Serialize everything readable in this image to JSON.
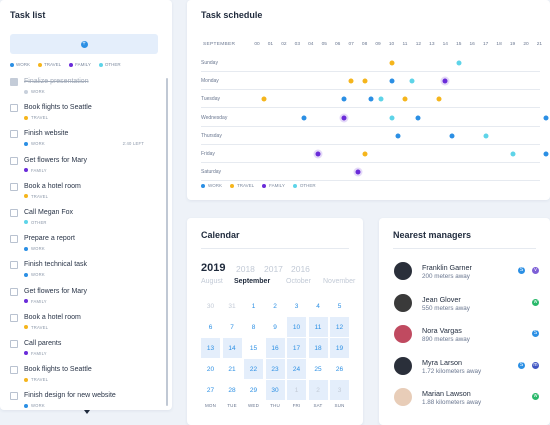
{
  "colors": {
    "work": "#2b8fe4",
    "travel": "#f5b51c",
    "family": "#6a2bd9",
    "other": "#5ed4e8",
    "accent": "#2b8fe4",
    "muted_text": "#8a96a8"
  },
  "task_list": {
    "title": "Task list",
    "legend": [
      {
        "label": "WORK",
        "color": "#2b8fe4"
      },
      {
        "label": "TRAVEL",
        "color": "#f5b51c"
      },
      {
        "label": "FAMILY",
        "color": "#6a2bd9"
      },
      {
        "label": "OTHER",
        "color": "#5ed4e8"
      }
    ],
    "items": [
      {
        "title": "Finalize presentation",
        "category": "WORK",
        "color": "#c8d0dc",
        "done": true,
        "left": ""
      },
      {
        "title": "Book flights to Seattle",
        "category": "TRAVEL",
        "color": "#f5b51c",
        "done": false,
        "left": ""
      },
      {
        "title": "Finish website",
        "category": "WORK",
        "color": "#2b8fe4",
        "done": false,
        "left": "2:40 LEFT"
      },
      {
        "title": "Get flowers for Mary",
        "category": "FAMILY",
        "color": "#6a2bd9",
        "done": false,
        "left": ""
      },
      {
        "title": "Book a hotel room",
        "category": "TRAVEL",
        "color": "#f5b51c",
        "done": false,
        "left": ""
      },
      {
        "title": "Call Megan Fox",
        "category": "OTHER",
        "color": "#5ed4e8",
        "done": false,
        "left": ""
      },
      {
        "title": "Prepare a report",
        "category": "WORK",
        "color": "#2b8fe4",
        "done": false,
        "left": ""
      },
      {
        "title": "Finish technical task",
        "category": "WORK",
        "color": "#2b8fe4",
        "done": false,
        "left": ""
      },
      {
        "title": "Get flowers for Mary",
        "category": "FAMILY",
        "color": "#6a2bd9",
        "done": false,
        "left": ""
      },
      {
        "title": "Book a hotel room",
        "category": "TRAVEL",
        "color": "#f5b51c",
        "done": false,
        "left": ""
      },
      {
        "title": "Call parents",
        "category": "FAMILY",
        "color": "#6a2bd9",
        "done": false,
        "left": ""
      },
      {
        "title": "Book flights to Seattle",
        "category": "TRAVEL",
        "color": "#f5b51c",
        "done": false,
        "left": ""
      },
      {
        "title": "Finish design for new website",
        "category": "WORK",
        "color": "#2b8fe4",
        "done": false,
        "left": ""
      }
    ]
  },
  "schedule": {
    "title": "Task schedule",
    "month_label": "SEPTEMBER",
    "hours": [
      "00",
      "01",
      "02",
      "03",
      "04",
      "05",
      "06",
      "07",
      "08",
      "09",
      "10",
      "11",
      "12",
      "13",
      "14",
      "15",
      "16",
      "17",
      "18",
      "19",
      "20",
      "21",
      "22",
      "23"
    ],
    "days": [
      "Sunday",
      "Monday",
      "Tuesday",
      "Wednesday",
      "Thursday",
      "Friday",
      "Saturday"
    ],
    "events": [
      {
        "day": 0,
        "hour": 10.0,
        "cat": "travel"
      },
      {
        "day": 0,
        "hour": 15.0,
        "cat": "other"
      },
      {
        "day": 1,
        "hour": 7.0,
        "cat": "travel"
      },
      {
        "day": 1,
        "hour": 8.0,
        "cat": "travel"
      },
      {
        "day": 1,
        "hour": 10.0,
        "cat": "work"
      },
      {
        "day": 1,
        "hour": 11.5,
        "cat": "other"
      },
      {
        "day": 1,
        "hour": 14.0,
        "cat": "family"
      },
      {
        "day": 2,
        "hour": 0.5,
        "cat": "travel"
      },
      {
        "day": 2,
        "hour": 6.5,
        "cat": "work"
      },
      {
        "day": 2,
        "hour": 8.5,
        "cat": "work"
      },
      {
        "day": 2,
        "hour": 9.2,
        "cat": "other"
      },
      {
        "day": 2,
        "hour": 11.0,
        "cat": "travel"
      },
      {
        "day": 2,
        "hour": 13.5,
        "cat": "travel"
      },
      {
        "day": 3,
        "hour": 3.5,
        "cat": "work"
      },
      {
        "day": 3,
        "hour": 6.5,
        "cat": "family"
      },
      {
        "day": 3,
        "hour": 10.0,
        "cat": "other"
      },
      {
        "day": 3,
        "hour": 12.0,
        "cat": "work"
      },
      {
        "day": 3,
        "hour": 21.5,
        "cat": "work"
      },
      {
        "day": 4,
        "hour": 10.5,
        "cat": "work"
      },
      {
        "day": 4,
        "hour": 14.5,
        "cat": "work"
      },
      {
        "day": 4,
        "hour": 17.0,
        "cat": "other"
      },
      {
        "day": 4,
        "hour": 22.5,
        "cat": "family"
      },
      {
        "day": 5,
        "hour": 4.5,
        "cat": "family"
      },
      {
        "day": 5,
        "hour": 8.0,
        "cat": "travel"
      },
      {
        "day": 5,
        "hour": 19.0,
        "cat": "other"
      },
      {
        "day": 5,
        "hour": 21.5,
        "cat": "work"
      },
      {
        "day": 6,
        "hour": 7.5,
        "cat": "family"
      }
    ],
    "legend": [
      {
        "label": "WORK",
        "color": "#2b8fe4"
      },
      {
        "label": "TRAVEL",
        "color": "#f5b51c"
      },
      {
        "label": "FAMILY",
        "color": "#6a2bd9"
      },
      {
        "label": "OTHER",
        "color": "#5ed4e8"
      }
    ]
  },
  "calendar": {
    "title": "Calendar",
    "years": [
      {
        "label": "2019",
        "active": true
      },
      {
        "label": "2018",
        "active": false
      },
      {
        "label": "2017",
        "active": false
      },
      {
        "label": "2016",
        "active": false
      }
    ],
    "months": [
      {
        "label": "August",
        "active": false
      },
      {
        "label": "September",
        "active": true
      },
      {
        "label": "October",
        "active": false
      },
      {
        "label": "November",
        "active": false
      }
    ],
    "weeks": [
      [
        {
          "d": "30",
          "m": true
        },
        {
          "d": "31",
          "m": true
        },
        {
          "d": "1"
        },
        {
          "d": "2"
        },
        {
          "d": "3"
        },
        {
          "d": "4"
        },
        {
          "d": "5"
        }
      ],
      [
        {
          "d": "6"
        },
        {
          "d": "7"
        },
        {
          "d": "8"
        },
        {
          "d": "9"
        },
        {
          "d": "10",
          "h": true
        },
        {
          "d": "11",
          "h": true
        },
        {
          "d": "12",
          "h": true
        }
      ],
      [
        {
          "d": "13",
          "h": true
        },
        {
          "d": "14",
          "h": true
        },
        {
          "d": "15"
        },
        {
          "d": "16",
          "h": true
        },
        {
          "d": "17",
          "h": true
        },
        {
          "d": "18",
          "h": true
        },
        {
          "d": "19",
          "h": true
        }
      ],
      [
        {
          "d": "20"
        },
        {
          "d": "21"
        },
        {
          "d": "22",
          "h": true
        },
        {
          "d": "23",
          "h": true
        },
        {
          "d": "24",
          "h": true
        },
        {
          "d": "25"
        },
        {
          "d": "26"
        }
      ],
      [
        {
          "d": "27"
        },
        {
          "d": "28"
        },
        {
          "d": "29"
        },
        {
          "d": "30",
          "h": true
        },
        {
          "d": "1",
          "m": true,
          "h": true
        },
        {
          "d": "2",
          "m": true,
          "h": true
        },
        {
          "d": "3",
          "m": true,
          "h": true
        }
      ]
    ],
    "dow": [
      "MON",
      "TUE",
      "WED",
      "THU",
      "FRI",
      "SAT",
      "SUN"
    ]
  },
  "managers": {
    "title": "Nearest managers",
    "items": [
      {
        "name": "Franklin Garner",
        "distance": "200 meters away",
        "avatar": "#2a2f3a",
        "apps": [
          {
            "icon": "skype-icon",
            "color": "#2b8fe4",
            "glyph": "S"
          },
          {
            "icon": "viber-icon",
            "color": "#7d5fd6",
            "glyph": "v"
          }
        ]
      },
      {
        "name": "Jean Glover",
        "distance": "550 meters away",
        "avatar": "#3a3a3a",
        "apps": [
          {
            "icon": "whatsapp-icon",
            "color": "#29b86a",
            "glyph": "w"
          }
        ]
      },
      {
        "name": "Nora Vargas",
        "distance": "890 meters away",
        "avatar": "#c04a60",
        "apps": [
          {
            "icon": "skype-icon",
            "color": "#2b8fe4",
            "glyph": "S"
          }
        ]
      },
      {
        "name": "Myra Larson",
        "distance": "1.72 kilometers away",
        "avatar": "#2a2f3a",
        "apps": [
          {
            "icon": "skype-icon",
            "color": "#2b8fe4",
            "glyph": "S"
          },
          {
            "icon": "chat-icon",
            "color": "#3f55c2",
            "glyph": "m"
          }
        ]
      },
      {
        "name": "Marian Lawson",
        "distance": "1.88 kilometers away",
        "avatar": "#e8cdb8",
        "apps": [
          {
            "icon": "whatsapp-icon",
            "color": "#29b86a",
            "glyph": "w"
          }
        ]
      }
    ]
  }
}
